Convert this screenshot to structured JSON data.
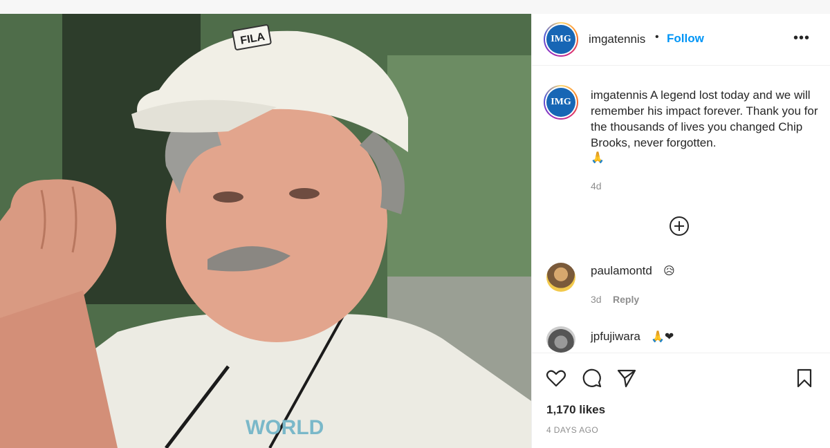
{
  "post": {
    "author": "imgatennis",
    "separator": "•",
    "follow_label": "Follow",
    "more_label": "•••",
    "avatar_text": "IMG",
    "brand_color": "#1766b5",
    "follow_color": "#0095f6"
  },
  "caption": {
    "username": "imgatennis",
    "text": "A legend lost today and we will remember his impact forever. Thank you for the thousands of lives you changed Chip Brooks, never forgotten.",
    "emoji": "🙏",
    "time": "4d"
  },
  "photo": {
    "cap_logo": "FILA",
    "shirt_text": "WORLD"
  },
  "comments": [
    {
      "username": "paulamontd",
      "emoji": "😥",
      "time": "3d",
      "reply_label": "Reply"
    },
    {
      "username": "jpfujiwara",
      "emoji": "🙏❤"
    }
  ],
  "actions": {
    "icons": [
      "heart-icon",
      "comment-icon",
      "share-icon",
      "bookmark-icon"
    ],
    "likes": "1,170 likes",
    "posted_ago": "4 DAYS AGO"
  }
}
